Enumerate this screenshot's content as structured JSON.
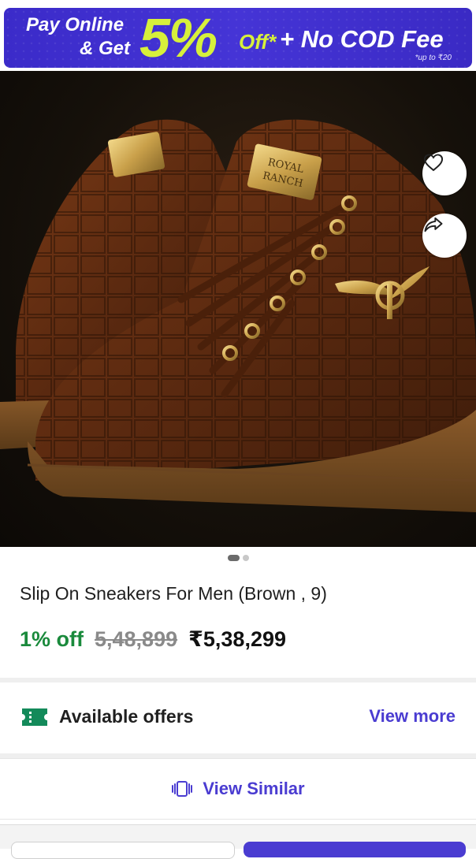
{
  "promo": {
    "line1": "Pay Online",
    "line2": "& Get",
    "percent": "5%",
    "off": "Off*",
    "headline": "+ No COD Fee",
    "fineprint": "*up to ₹20"
  },
  "product": {
    "title": "Slip On Sneakers For Men (Brown , 9)",
    "discount": "1% off",
    "mrp": "5,48,899",
    "price": "₹5,38,299",
    "brand_tag": "ROYAL RANCH"
  },
  "carousel": {
    "total": 2,
    "active": 1
  },
  "actions": {
    "wishlist_icon": "heart-icon",
    "share_icon": "share-icon"
  },
  "offers": {
    "label": "Available offers",
    "link": "View more",
    "icon": "ticket-icon"
  },
  "similar": {
    "label": "View Similar",
    "icon": "view-similar-icon"
  },
  "colors": {
    "accent": "#4a3cd1",
    "discount": "#1a8a3c",
    "promo_bg": "#3b2bc9",
    "promo_highlight": "#d7f03b"
  }
}
